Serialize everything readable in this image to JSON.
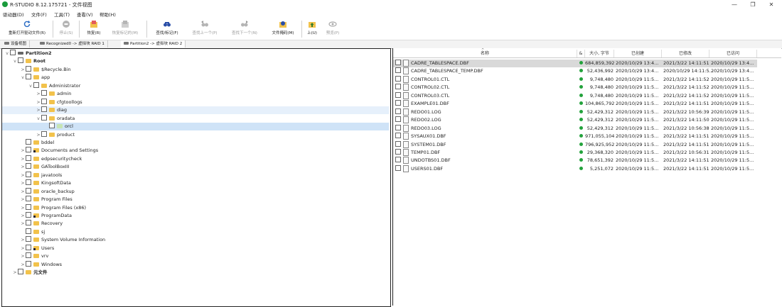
{
  "window": {
    "title": "R-STUDIO 8.12.175721 - 文件视图",
    "min": "—",
    "restore": "❐",
    "close": "✕"
  },
  "menu": [
    "驱动器(D)",
    "文件(F)",
    "工具(T)",
    "查看(V)",
    "帮助(H)"
  ],
  "toolbar": [
    {
      "label": "重新打开驱动文件(R)",
      "icon": "reopen-icon",
      "enabled": true
    },
    {
      "label": "停止(S)",
      "icon": "stop-icon",
      "enabled": false
    },
    {
      "label": "恢复(R)",
      "icon": "recover-icon",
      "enabled": true
    },
    {
      "label": "恢复标记的(M)",
      "icon": "recover-marked-icon",
      "enabled": false
    },
    {
      "label": "查找/标记(F)",
      "icon": "find-icon",
      "enabled": true
    },
    {
      "label": "查找上一个(P)",
      "icon": "find-prev-icon",
      "enabled": false
    },
    {
      "label": "查找下一个(N)",
      "icon": "find-next-icon",
      "enabled": false
    },
    {
      "label": "文件掩码(M)",
      "icon": "file-mask-icon",
      "enabled": true
    },
    {
      "label": "上(U)",
      "icon": "up-folder-icon",
      "enabled": true
    },
    {
      "label": "预览(P)",
      "icon": "preview-icon",
      "enabled": false
    }
  ],
  "tabs": [
    "设备视图",
    "Recognized0 -> 虚拟块 RAID 1",
    "Partition2 -> 虚拟块 RAID 2"
  ],
  "tree": [
    {
      "label": "Partition2",
      "depth": 0,
      "chev": "v",
      "bold": true,
      "icon": "drive"
    },
    {
      "label": "Root",
      "depth": 1,
      "chev": "v",
      "bold": true,
      "icon": "folder"
    },
    {
      "label": "$Recycle.Bin",
      "depth": 2,
      "chev": ">",
      "icon": "folder"
    },
    {
      "label": "app",
      "depth": 2,
      "chev": "v",
      "icon": "folder"
    },
    {
      "label": "Administrator",
      "depth": 3,
      "chev": "v",
      "icon": "folder"
    },
    {
      "label": "admin",
      "depth": 4,
      "chev": ">",
      "icon": "folder"
    },
    {
      "label": "cfgtoollogs",
      "depth": 4,
      "chev": ">",
      "icon": "folder"
    },
    {
      "label": "diag",
      "depth": 4,
      "chev": ">",
      "icon": "folder",
      "hl": 1
    },
    {
      "label": "oradata",
      "depth": 4,
      "chev": "v",
      "icon": "folder"
    },
    {
      "label": "orcl",
      "depth": 5,
      "chev": "",
      "icon": "db",
      "hl": 2
    },
    {
      "label": "product",
      "depth": 4,
      "chev": ">",
      "icon": "folder"
    },
    {
      "label": "bddel",
      "depth": 2,
      "chev": "",
      "icon": "folder"
    },
    {
      "label": "Documents and Settings",
      "depth": 2,
      "chev": ">",
      "icon": "sys"
    },
    {
      "label": "edpsecuritycheck",
      "depth": 2,
      "chev": ">",
      "icon": "folder"
    },
    {
      "label": "GAToolBoxIII",
      "depth": 2,
      "chev": ">",
      "icon": "folder"
    },
    {
      "label": "javatools",
      "depth": 2,
      "chev": ">",
      "icon": "folder"
    },
    {
      "label": "KingsoftData",
      "depth": 2,
      "chev": ">",
      "icon": "folder"
    },
    {
      "label": "oracle_backup",
      "depth": 2,
      "chev": ">",
      "icon": "folder"
    },
    {
      "label": "Program Files",
      "depth": 2,
      "chev": ">",
      "icon": "folder"
    },
    {
      "label": "Program Files (x86)",
      "depth": 2,
      "chev": ">",
      "icon": "folder"
    },
    {
      "label": "ProgramData",
      "depth": 2,
      "chev": ">",
      "icon": "sys"
    },
    {
      "label": "Recovery",
      "depth": 2,
      "chev": ">",
      "icon": "folder"
    },
    {
      "label": "sj",
      "depth": 2,
      "chev": "",
      "icon": "folder"
    },
    {
      "label": "System Volume Information",
      "depth": 2,
      "chev": ">",
      "icon": "folder"
    },
    {
      "label": "Users",
      "depth": 2,
      "chev": ">",
      "icon": "sys"
    },
    {
      "label": "vrv",
      "depth": 2,
      "chev": ">",
      "icon": "folder"
    },
    {
      "label": "Windows",
      "depth": 2,
      "chev": ">",
      "icon": "folder"
    },
    {
      "label": "元文件",
      "depth": 1,
      "chev": ">",
      "bold": true,
      "icon": "folder"
    }
  ],
  "columns": [
    "名称",
    "&",
    "大小, 字节",
    "已创建",
    "已修改",
    "已访问"
  ],
  "files": [
    {
      "name": "CADRE_TABLESPACE.DBF",
      "size": "684,859,392",
      "created": "2020/10/29 13:4...",
      "modified": "2021/3/22 14:11:51",
      "accessed": "2020/10/29 13:4...",
      "selected": true
    },
    {
      "name": "CADRE_TABLESPACE_TEMP.DBF",
      "size": "52,436,992",
      "created": "2020/10/29 13:4...",
      "modified": "2020/10/29 14:11:5...",
      "accessed": "2020/10/29 13:4..."
    },
    {
      "name": "CONTROL01.CTL",
      "size": "9,748,480",
      "created": "2020/10/29 11:5...",
      "modified": "2021/3/22 14:11:52",
      "accessed": "2020/10/29 11:5..."
    },
    {
      "name": "CONTROL02.CTL",
      "size": "9,748,480",
      "created": "2020/10/29 11:5...",
      "modified": "2021/3/22 14:11:52",
      "accessed": "2020/10/29 11:5..."
    },
    {
      "name": "CONTROL03.CTL",
      "size": "9,748,480",
      "created": "2020/10/29 11:5...",
      "modified": "2021/3/22 14:11:52",
      "accessed": "2020/10/29 11:5..."
    },
    {
      "name": "EXAMPLE01.DBF",
      "size": "104,865,792",
      "created": "2020/10/29 11:5...",
      "modified": "2021/3/22 14:11:51",
      "accessed": "2020/10/29 11:5..."
    },
    {
      "name": "REDO01.LOG",
      "size": "52,429,312",
      "created": "2020/10/29 11:5...",
      "modified": "2021/3/22 10:56:39",
      "accessed": "2020/10/29 11:5..."
    },
    {
      "name": "REDO02.LOG",
      "size": "52,429,312",
      "created": "2020/10/29 11:5...",
      "modified": "2021/3/22 14:11:50",
      "accessed": "2020/10/29 11:5..."
    },
    {
      "name": "REDO03.LOG",
      "size": "52,429,312",
      "created": "2020/10/29 11:5...",
      "modified": "2021/3/22 10:56:38",
      "accessed": "2020/10/29 11:5..."
    },
    {
      "name": "SYSAUX01.DBF",
      "size": "971,055,104",
      "created": "2020/10/29 11:5...",
      "modified": "2021/3/22 14:11:51",
      "accessed": "2020/10/29 11:5..."
    },
    {
      "name": "SYSTEM01.DBF",
      "size": "796,925,952",
      "created": "2020/10/29 11:5...",
      "modified": "2021/3/22 14:11:51",
      "accessed": "2020/10/29 11:5..."
    },
    {
      "name": "TEMP01.DBF",
      "size": "29,368,320",
      "created": "2020/10/29 11:5...",
      "modified": "2021/3/22 10:56:31",
      "accessed": "2020/10/29 11:5..."
    },
    {
      "name": "UNDOTBS01.DBF",
      "size": "78,651,392",
      "created": "2020/10/29 11:5...",
      "modified": "2021/3/22 14:11:51",
      "accessed": "2020/10/29 11:5..."
    },
    {
      "name": "USERS01.DBF",
      "size": "5,251,072",
      "created": "2020/10/29 11:5...",
      "modified": "2021/3/22 14:11:51",
      "accessed": "2020/10/29 11:5..."
    }
  ],
  "colors": {
    "status_dot": "#23a23c",
    "folder": "#f2c24b",
    "selection": "#d9d9d9"
  }
}
